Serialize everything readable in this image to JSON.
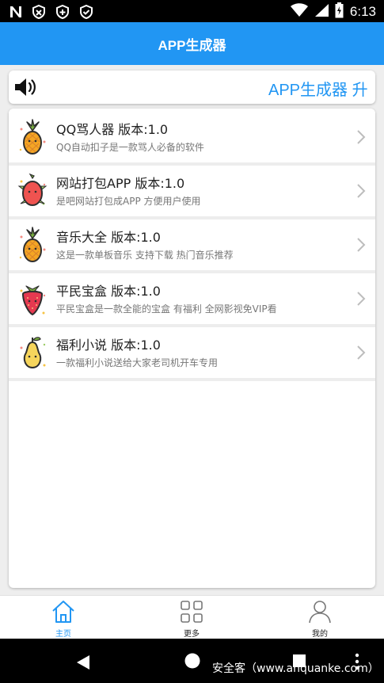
{
  "status_bar": {
    "time": "6:13",
    "left_icons": [
      "n-icon",
      "shield-x-icon",
      "shield-plus-icon",
      "shield-check-icon"
    ],
    "right_icons": [
      "wifi-icon",
      "signal-icon",
      "battery-icon"
    ]
  },
  "header": {
    "title": "APP生成器"
  },
  "notice": {
    "icon": "speaker-icon",
    "text": "APP生成器 升"
  },
  "apps": [
    {
      "icon": "pineapple-icon",
      "title": "QQ骂人器 版本:1.0",
      "desc": "QQ自动扣子是一款骂人必备的软件"
    },
    {
      "icon": "pitaya-icon",
      "title": "网站打包APP 版本:1.0",
      "desc": "是吧网站打包成APP 方便用户使用"
    },
    {
      "icon": "pineapple-icon",
      "title": "音乐大全 版本:1.0",
      "desc": "这是一款单板音乐 支持下载 热门音乐推荐"
    },
    {
      "icon": "strawberry-icon",
      "title": "平民宝盒 版本:1.0",
      "desc": "平民宝盒是一款全能的宝盒 有福利 全网影视免VIP看"
    },
    {
      "icon": "pear-icon",
      "title": "福利小说 版本:1.0",
      "desc": "一款福利小说送给大家老司机开车专用"
    }
  ],
  "tabs": [
    {
      "label": "主页",
      "icon": "home-icon",
      "active": true
    },
    {
      "label": "更多",
      "icon": "grid-icon",
      "active": false
    },
    {
      "label": "我的",
      "icon": "user-icon",
      "active": false
    }
  ],
  "watermark": "安全客（www.anquanke.com）",
  "colors": {
    "accent": "#2196f3",
    "status_bar": "#000000",
    "background": "#eeeeee"
  }
}
